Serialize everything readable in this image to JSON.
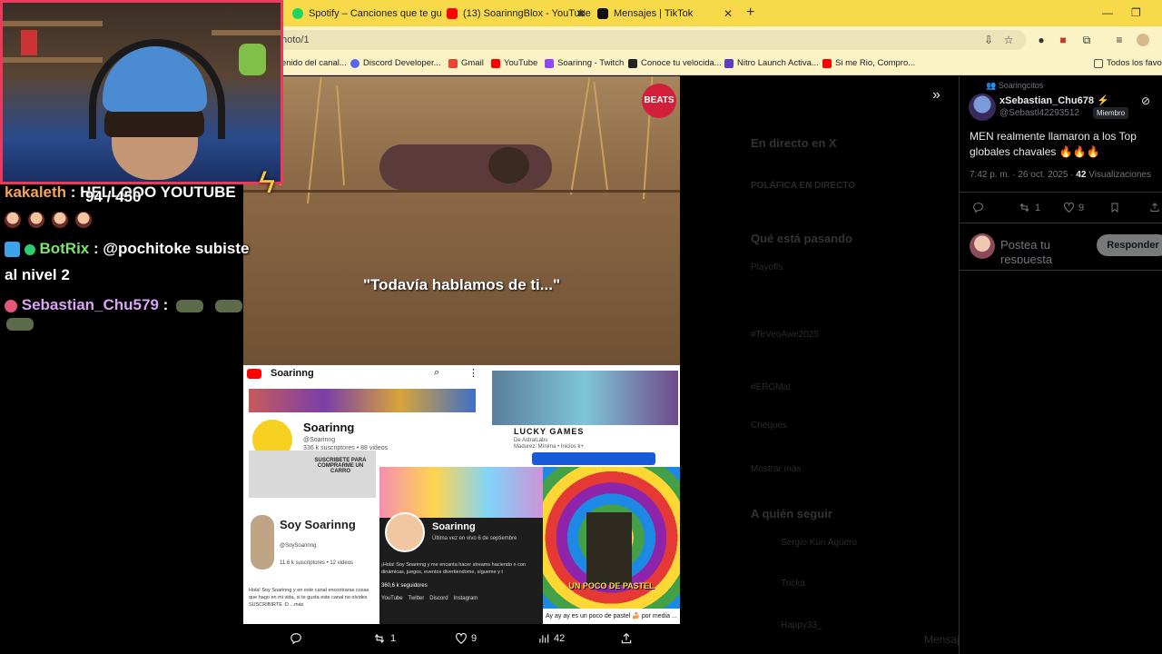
{
  "browser": {
    "tabs": [
      {
        "label": "Spotify – Canciones que te gust",
        "color": "#1ed760"
      },
      {
        "label": "(13) SoarinngBlox - YouTube",
        "color": "#ff0000"
      },
      {
        "label": "Mensajes | TikTok",
        "color": "#111111"
      }
    ],
    "url": "hoto/1",
    "bookmarks": [
      {
        "label": "enido del canal...",
        "color": "#e23b3b"
      },
      {
        "label": "Discord Developer...",
        "color": "#5865f2"
      },
      {
        "label": "Gmail",
        "color": "#ea4335"
      },
      {
        "label": "YouTube",
        "color": "#ff0000"
      },
      {
        "label": "Soarinng - Twitch",
        "color": "#9146ff"
      },
      {
        "label": "Conoce tu velocida...",
        "color": "#222222"
      },
      {
        "label": "Nitro Launch Activa...",
        "color": "#5c3dbd"
      },
      {
        "label": "Si me Rio, Compro...",
        "color": "#ff0000"
      }
    ],
    "all_bookmarks": "Todos los favori"
  },
  "overlay": {
    "follower_counter": "94 / 450",
    "chat": [
      {
        "user": "kakaleth",
        "user_color": "#f5a35c",
        "text": ": HELLOOO YOUTUBE"
      },
      {
        "user": "BotRix",
        "user_color": "#7ee36f",
        "text": ": @pochitoke subiste"
      },
      {
        "user": "",
        "user_color": "#ffffff",
        "text": "al nivel 2"
      },
      {
        "user": "Sebastian_Chu579",
        "user_color": "#d9a4f5",
        "text": ":"
      }
    ]
  },
  "media": {
    "quote": "\"Todavía hablamos de ti...\"",
    "beats_logo": "BEATS",
    "yt_card": {
      "brand": "Soarinng",
      "channel": "Soarinng",
      "handle": "@Soarinng",
      "stats": "336 k suscriptores • 88 videos",
      "subscribe_note": "SUSCRIBETE PARA COMPRARME UN CARRO",
      "alt_channel": "Soy Soarinng",
      "alt_handle": "@SoySoarinng",
      "alt_stats": "11.6 k suscriptores • 12 videos",
      "alt_desc": "Hola! Soy Soarinng y en este canal encontraras cosas que hago en mi vida, si te gusta este canal no olvides SUSCRIBIRTE :D ...más"
    },
    "lucky": {
      "title": "LUCKY GAMES",
      "sub": "De AstralLabs",
      "meta": "Madurez: Mínima • Inicios k+"
    },
    "twitch_card": {
      "name": "Soarinng",
      "last_live": "Última vez en vivo 6 de septiembre",
      "desc": "¡Hola! Soy Soarinng y me encanta hacer streams haciendo n con dinámicas, juegos, eventos divertiendome, sígueme y t",
      "followers": "360,6 k seguidores",
      "links": [
        "YouTube",
        "Twitter",
        "Discord",
        "Instagram"
      ]
    },
    "rainbow": {
      "title": "UN POCO DE PASTEL",
      "caption": "Ay ay ay es un poco de pastel 🍰 por media ..."
    },
    "actions": {
      "replies": "",
      "retweets": "1",
      "likes": "9",
      "views": "42"
    }
  },
  "background_page": {
    "live_heading": "En directo en X",
    "live_item": "POLÁFICA EN DIRECTO",
    "trends_heading": "Qué está pasando",
    "trends": [
      "Playoffs",
      "#TeVeoAwe2025",
      "#EROMat",
      "Cheques"
    ],
    "show_more": "Mostrar más",
    "follow_heading": "A quién seguir",
    "follow": [
      "Sergio Kun Agüero",
      "Tricka",
      "Happy33_"
    ],
    "messages": "Mensajes"
  },
  "tweet": {
    "community": "Soaringcitos",
    "author": "xSebastian_Chu678 ⚡",
    "handle": "@Sebastl42293512",
    "badge": "Miembro",
    "text": "MEN realmente llamaron a los Top globales chavales 🔥🔥🔥",
    "time": "7:42 p. m. · 26 oct. 2025 · ",
    "views_count": "42",
    "views_label": " Visualizaciones",
    "replies": "",
    "retweets": "1",
    "likes": "9",
    "reply_placeholder": "Postea tu respuesta",
    "reply_button": "Responder"
  }
}
